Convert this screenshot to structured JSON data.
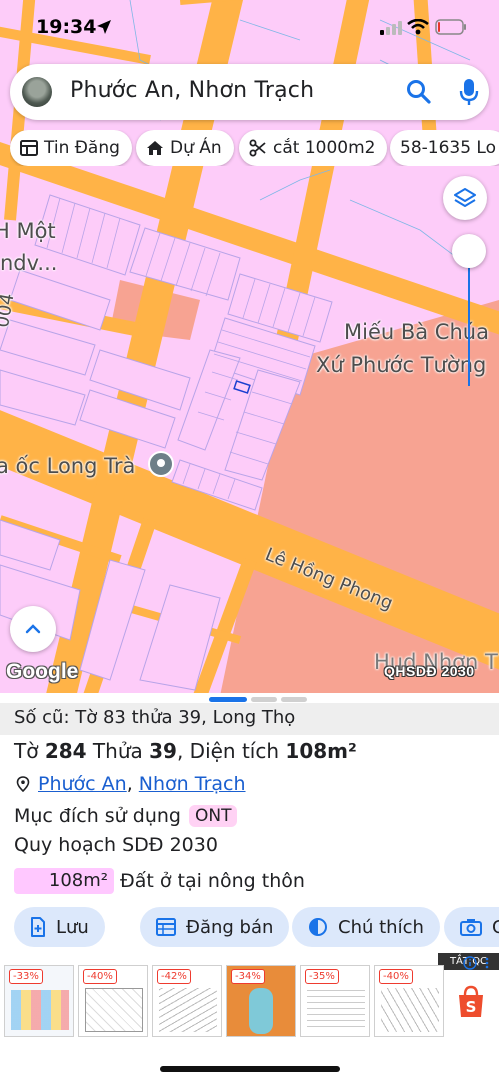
{
  "status_bar": {
    "time": "19:34"
  },
  "search": {
    "query": "Phước An, Nhơn Trạch"
  },
  "chips": [
    {
      "label": "Tin Đăng",
      "icon": "listing-icon"
    },
    {
      "label": "Dự Án",
      "icon": "project-house-icon"
    },
    {
      "label": "cắt 1000m2",
      "icon": "scissors-icon"
    },
    {
      "label": "58-1635 Lo",
      "icon": ""
    }
  ],
  "map": {
    "labels": {
      "mot": "H Một",
      "ndv": "ndv...",
      "road_left": "004",
      "mieu": "Miếu Bà Chúa",
      "xu": "Xứ Phước Tường",
      "long_tra": "a ốc Long Trà",
      "le_hong_phong": "Lê Hồng Phong",
      "hud": "Hud Nhơn T"
    },
    "google": "Google",
    "layer_code": "QHSDĐ 2030",
    "colors": {
      "residential": "#fdccf9",
      "road": "#ffb347",
      "public": "#f7a392"
    }
  },
  "sheet": {
    "old_parcel": "Số cũ: Tờ 83 thửa 39, Long Thọ",
    "title": {
      "to_label": "Tờ",
      "to": "284",
      "thua_label": "Thửa",
      "thua": "39",
      "area_label": "Diện tích",
      "area": "108m²"
    },
    "location": {
      "ward": "Phước An",
      "separator": ", ",
      "district": "Nhơn Trạch"
    },
    "purpose": {
      "label": "Mục đích sử dụng",
      "code": "ONT"
    },
    "plan": "Quy hoạch SDĐ 2030",
    "area_row": {
      "value": "108m²",
      "description": "Đất ở tại nông thôn"
    },
    "actions": [
      {
        "label": "Lưu",
        "icon": "add-document-icon"
      },
      {
        "label": "Đăng bán",
        "icon": "calendar-post-icon"
      },
      {
        "label": "Chú thích",
        "icon": "legend-contrast-icon"
      },
      {
        "label": "C",
        "icon": "camera-icon"
      }
    ]
  },
  "ad": {
    "close_label": "TẮT QC",
    "discounts": [
      "-33%",
      "-40%",
      "-42%",
      "-34%",
      "-35%",
      "-40%"
    ],
    "shop": "shopee-icon"
  }
}
